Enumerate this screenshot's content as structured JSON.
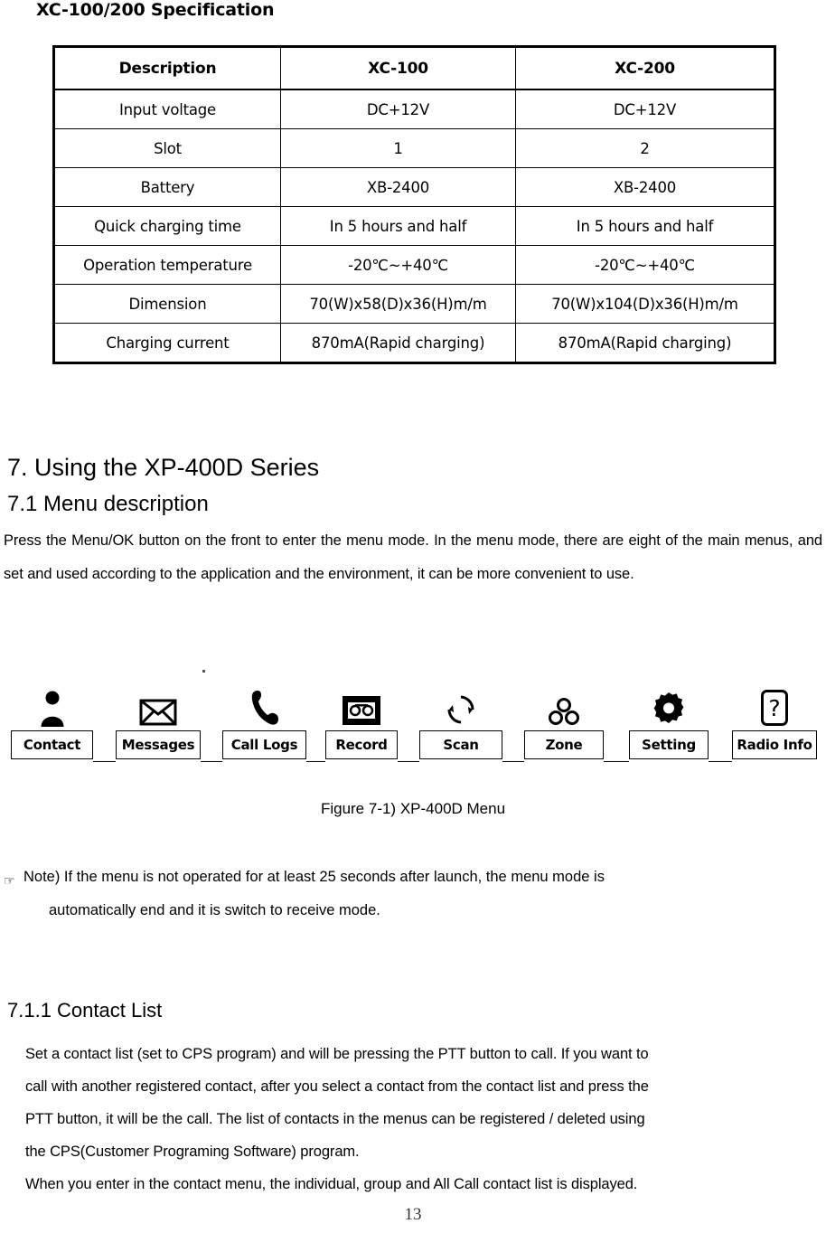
{
  "page": {
    "title": "XC-100/200 Specification",
    "page_number": "13"
  },
  "spec_table": {
    "headers": [
      "Description",
      "XC-100",
      "XC-200"
    ],
    "rows": [
      [
        "Input voltage",
        "DC+12V",
        "DC+12V"
      ],
      [
        "Slot",
        "1",
        "2"
      ],
      [
        "Battery",
        "XB-2400",
        "XB-2400"
      ],
      [
        "Quick charging time",
        "In 5 hours and half",
        "In 5 hours and half"
      ],
      [
        "Operation temperature",
        "-20℃~+40℃",
        "-20℃~+40℃"
      ],
      [
        "Dimension",
        "70(W)x58(D)x36(H)m/m",
        "70(W)x104(D)x36(H)m/m"
      ],
      [
        "Charging current",
        "870mA(Rapid charging)",
        "870mA(Rapid charging)"
      ]
    ]
  },
  "sections": {
    "chapter_heading": "7.  Using the XP-400D  Series",
    "sub_heading": "7.1  Menu description",
    "intro_paragraph": "Press the Menu/OK button on the front to enter the menu mode. In the menu mode, there are eight of the main menus, and set and used according to the application and the environment, it can be more convenient to use.",
    "contact_heading": "7.1.1 Contact List",
    "contact_lines": [
      "Set a contact list (set to CPS program) and will be pressing the PTT button to call. If you want to",
      "call with another registered contact, after you select a contact from the contact list and press the",
      "PTT button, it will be the call. The list of contacts in the menus can be registered / deleted using",
      "the CPS(Customer Programing Software) program.",
      "When you enter in the contact menu, the individual, group and All Call contact list is displayed."
    ]
  },
  "figure": {
    "caption": "Figure 7-1) XP-400D Menu",
    "menu_items": [
      {
        "label": "Contact",
        "icon": "person-icon"
      },
      {
        "label": "Messages",
        "icon": "envelope-icon"
      },
      {
        "label": "Call Logs",
        "icon": "phone-handset-icon"
      },
      {
        "label": "Record",
        "icon": "cassette-tape-icon"
      },
      {
        "label": "Scan",
        "icon": "circular-arrows-icon"
      },
      {
        "label": "Zone",
        "icon": "three-circles-icon"
      },
      {
        "label": "Setting",
        "icon": "gear-icon"
      },
      {
        "label": "Radio Info",
        "icon": "question-mark-icon"
      }
    ]
  },
  "note": {
    "marker": "☞",
    "line1": "Note) If the menu is not operated for at least 25 seconds after launch, the menu mode is",
    "line2": "automatically end and it is switch to receive mode."
  }
}
